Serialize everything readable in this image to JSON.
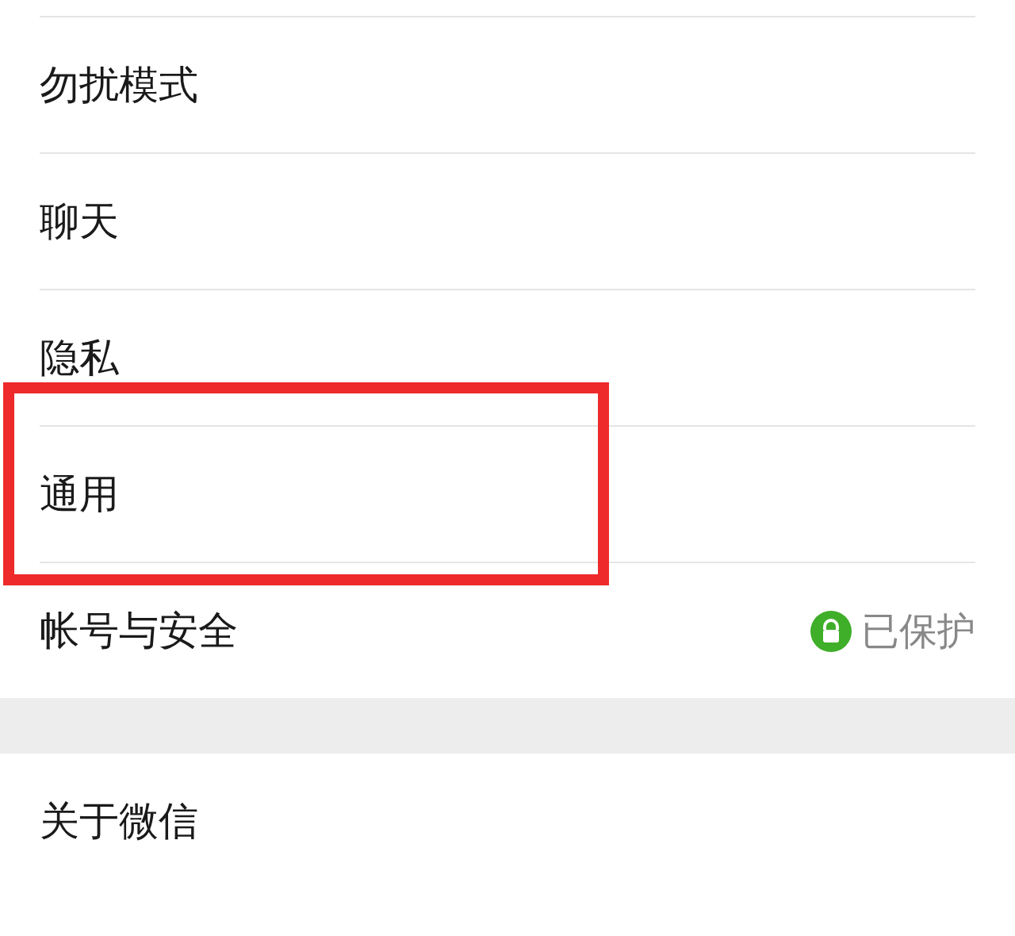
{
  "groups": [
    {
      "items": [
        {
          "label": "勿扰模式",
          "highlighted": false
        },
        {
          "label": "聊天",
          "highlighted": false
        },
        {
          "label": "隐私",
          "highlighted": false
        },
        {
          "label": "通用",
          "highlighted": true
        },
        {
          "label": "帐号与安全",
          "highlighted": false,
          "status": {
            "kind": "lock",
            "text": "已保护"
          }
        }
      ]
    },
    {
      "items": [
        {
          "label": "关于微信",
          "highlighted": false
        }
      ]
    }
  ]
}
